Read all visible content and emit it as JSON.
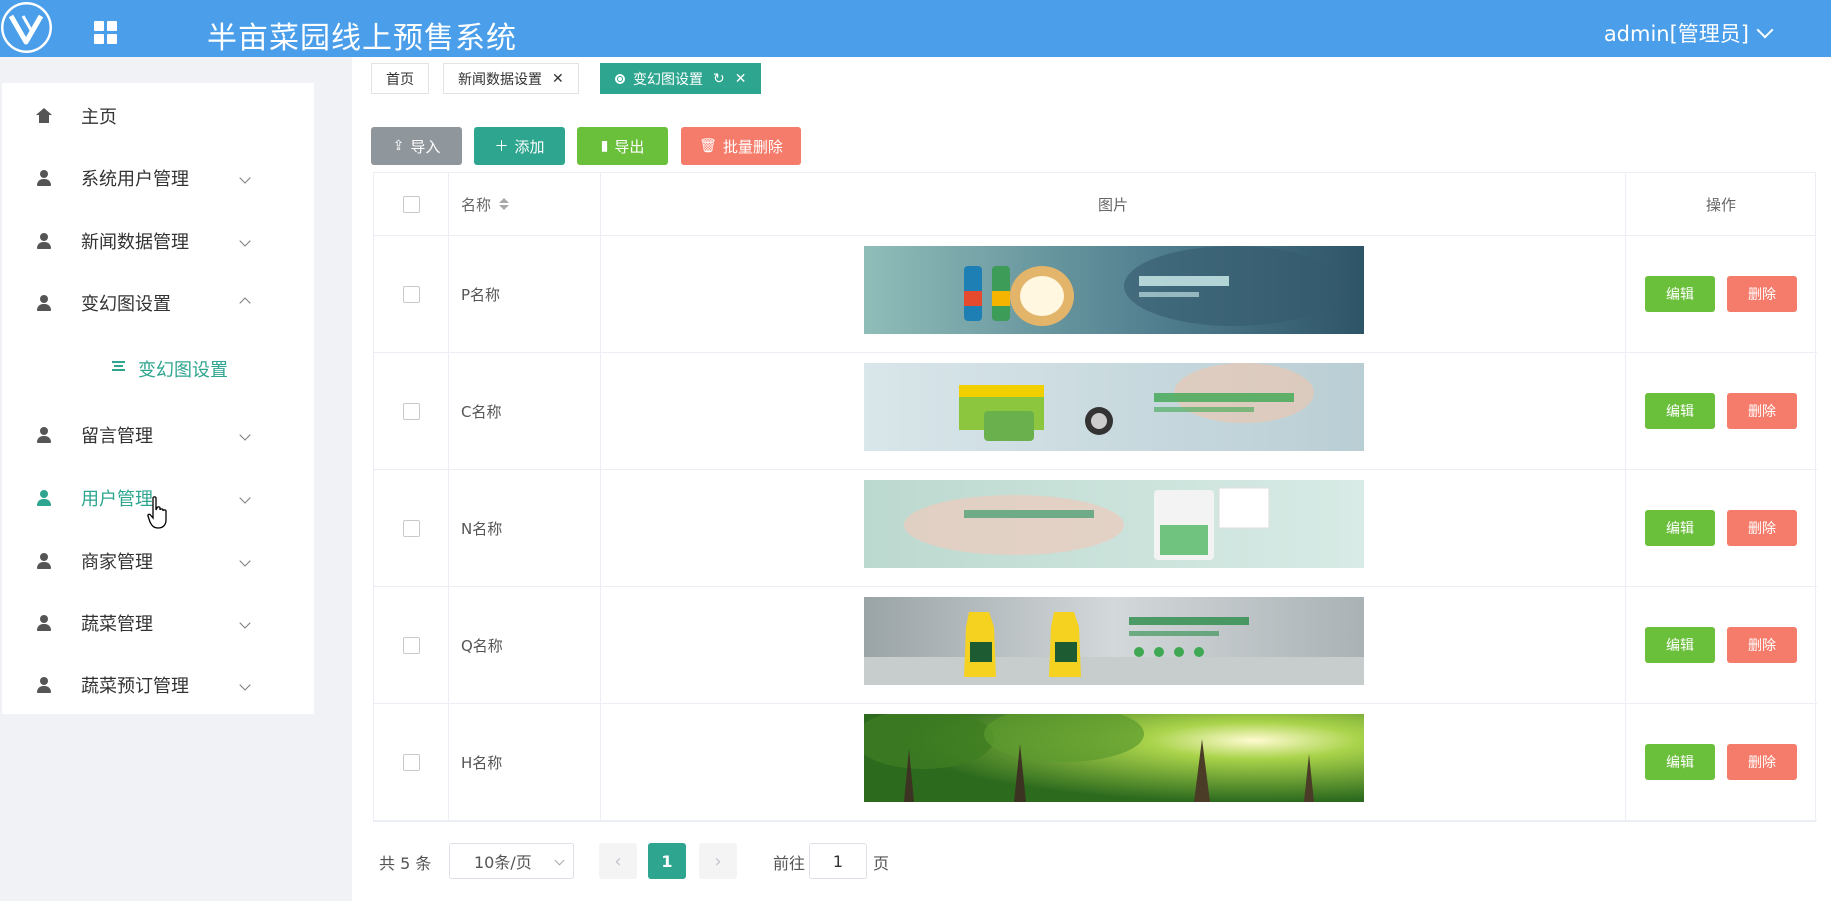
{
  "header": {
    "title": "半亩菜园线上预售系统",
    "user": "admin[管理员]"
  },
  "sidebar": {
    "items": [
      {
        "label": "主页"
      },
      {
        "label": "系统用户管理"
      },
      {
        "label": "新闻数据管理"
      },
      {
        "label": "变幻图设置"
      },
      {
        "label": "留言管理"
      },
      {
        "label": "用户管理"
      },
      {
        "label": "商家管理"
      },
      {
        "label": "蔬菜管理"
      },
      {
        "label": "蔬菜预订管理"
      }
    ],
    "sub_item": "变幻图设置"
  },
  "tabs": [
    {
      "label": "首页"
    },
    {
      "label": "新闻数据设置"
    },
    {
      "label": "变幻图设置"
    }
  ],
  "toolbar": {
    "import": "导入",
    "add": "添加",
    "export": "导出",
    "batch_delete": "批量删除"
  },
  "table": {
    "headers": {
      "name": "名称",
      "image": "图片",
      "action": "操作"
    },
    "rows": [
      {
        "name": "P名称",
        "edit": "编辑",
        "delete": "删除",
        "image_theme": "mosquito-repellent-products-bedroom"
      },
      {
        "name": "C名称",
        "edit": "编辑",
        "delete": "删除",
        "image_theme": "mosquito-coil-box-baby"
      },
      {
        "name": "N名称",
        "edit": "编辑",
        "delete": "删除",
        "image_theme": "sleeping-baby-liquid-repellent"
      },
      {
        "name": "Q名称",
        "edit": "编辑",
        "delete": "删除",
        "image_theme": "yellow-spray-bottles-kitchen"
      },
      {
        "name": "H名称",
        "edit": "编辑",
        "delete": "删除",
        "image_theme": "green-forest-sunlight"
      }
    ]
  },
  "pagination": {
    "total": "共 5 条",
    "page_size": "10条/页",
    "current": "1",
    "goto_label": "前往",
    "goto_value": "1",
    "page_suffix": "页"
  },
  "colors": {
    "header": "#4a9eea",
    "accent": "#2ea58f",
    "success": "#6abf3b",
    "danger": "#f57c6b",
    "muted": "#8f969c"
  }
}
